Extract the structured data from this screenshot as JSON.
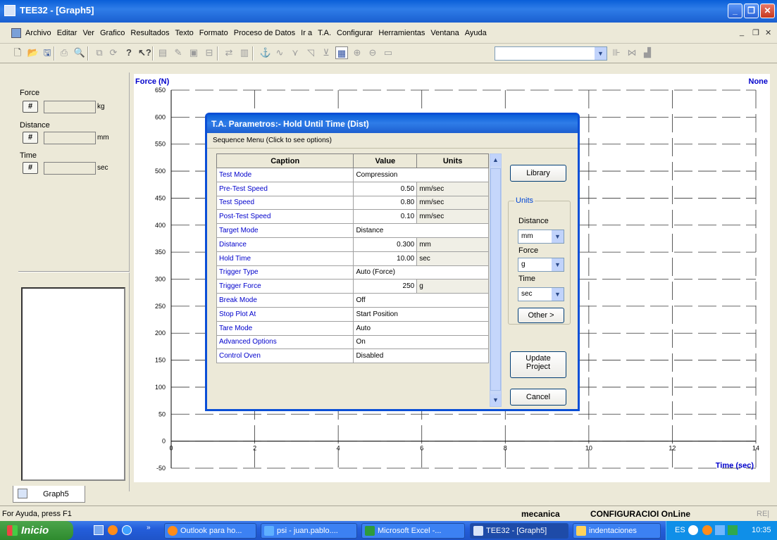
{
  "window": {
    "title": "TEE32 - [Graph5]"
  },
  "menu": [
    "Archivo",
    "Editar",
    "Ver",
    "Grafico",
    "Resultados",
    "Texto",
    "Formato",
    "Proceso de Datos",
    "Ir a",
    "T.A.",
    "Configurar",
    "Herramientas",
    "Ventana",
    "Ayuda"
  ],
  "left_panel": {
    "force_label": "Force",
    "force_unit": "kg",
    "distance_label": "Distance",
    "distance_unit": "mm",
    "time_label": "Time",
    "time_unit": "sec",
    "hash": "#"
  },
  "graph": {
    "y_title": "Force (N)",
    "x_title": "Time (sec)",
    "right_label": "None",
    "y_ticks": [
      "650",
      "600",
      "550",
      "500",
      "450",
      "400",
      "350",
      "300",
      "250",
      "200",
      "150",
      "100",
      "50",
      "0",
      "-50"
    ],
    "x_ticks": [
      "0",
      "2",
      "4",
      "6",
      "8",
      "10",
      "12",
      "14"
    ]
  },
  "dialog": {
    "title": "T.A. Parametros:- Hold Until Time (Dist)",
    "sequence_menu": "Sequence Menu (Click to see options)",
    "col_caption": "Caption",
    "col_value": "Value",
    "col_units": "Units",
    "rows": [
      {
        "caption": "Test Mode",
        "value": "Compression",
        "units": ""
      },
      {
        "caption": "Pre-Test Speed",
        "value": "0.50",
        "units": "mm/sec"
      },
      {
        "caption": "Test Speed",
        "value": "0.80",
        "units": "mm/sec"
      },
      {
        "caption": "Post-Test Speed",
        "value": "0.10",
        "units": "mm/sec"
      },
      {
        "caption": "Target Mode",
        "value": "Distance",
        "units": ""
      },
      {
        "caption": "Distance",
        "value": "0.300",
        "units": "mm"
      },
      {
        "caption": "Hold Time",
        "value": "10.00",
        "units": "sec"
      },
      {
        "caption": "Trigger Type",
        "value": "Auto (Force)",
        "units": ""
      },
      {
        "caption": "Trigger Force",
        "value": "250",
        "units": "g"
      },
      {
        "caption": "Break Mode",
        "value": "Off",
        "units": ""
      },
      {
        "caption": "Stop Plot At",
        "value": "Start Position",
        "units": ""
      },
      {
        "caption": "Tare Mode",
        "value": "Auto",
        "units": ""
      },
      {
        "caption": "Advanced Options",
        "value": "On",
        "units": ""
      },
      {
        "caption": "Control Oven",
        "value": "Disabled",
        "units": ""
      }
    ],
    "library_button": "Library",
    "units_group": "Units",
    "distance_label": "Distance",
    "distance_value": "mm",
    "force_label": "Force",
    "force_value": "g",
    "time_label": "Time",
    "time_value": "sec",
    "other_button": "Other >",
    "update_button_line1": "Update",
    "update_button_line2": "Project",
    "cancel_button": "Cancel"
  },
  "tab": {
    "label": "Graph5"
  },
  "status": {
    "help": "For Ayuda, press F1",
    "user": "mecanica",
    "config": "CONFIGURACIOI OnLine",
    "extra": "RE|"
  },
  "taskbar": {
    "start": "Inicio",
    "tasks": [
      "Outlook para ho...",
      "psi - juan.pablo....",
      "Microsoft Excel -...",
      "TEE32 - [Graph5]",
      "indentaciones"
    ],
    "lang": "ES",
    "clock": "10:35"
  }
}
